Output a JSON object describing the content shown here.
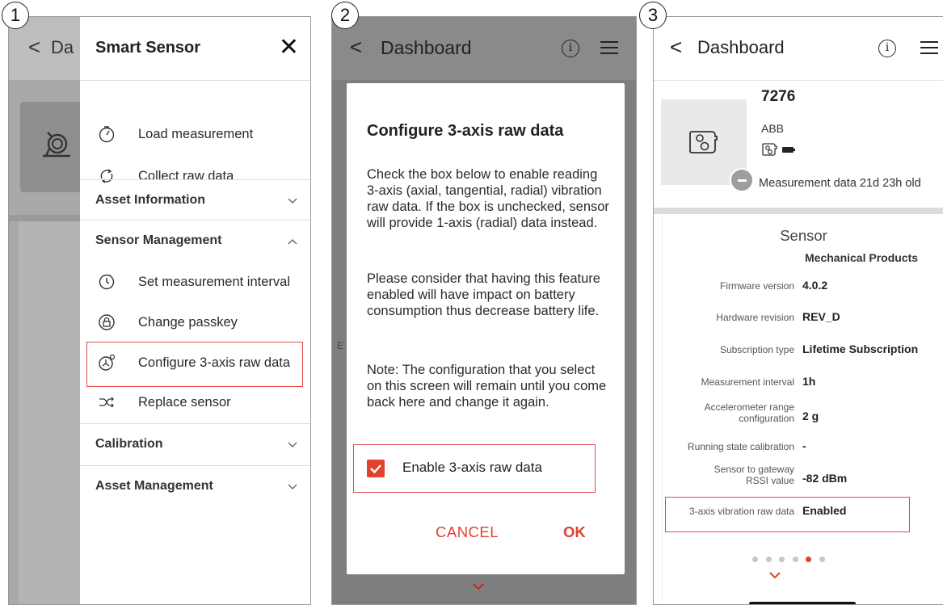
{
  "steps": [
    "1",
    "2",
    "3"
  ],
  "panel1": {
    "bg_back": "<",
    "bg_title": "Da",
    "drawer": {
      "title": "Smart Sensor",
      "close": "✕",
      "items_top": [
        {
          "label": "Load measurement",
          "icon": "gauge-icon"
        },
        {
          "label": "Collect raw data",
          "icon": "refresh-icon"
        }
      ],
      "sections": [
        {
          "label": "Asset Information",
          "chev": "⌄"
        },
        {
          "label": "Sensor Management",
          "chev": "⌃"
        },
        {
          "label": "Calibration",
          "chev": "⌄"
        },
        {
          "label": "Asset Management",
          "chev": "⌄"
        }
      ],
      "sensor_items": [
        {
          "label": "Set measurement interval",
          "icon": "timer-icon"
        },
        {
          "label": "Change passkey",
          "icon": "lock-icon"
        },
        {
          "label": "Configure 3-axis raw data",
          "icon": "axis-icon"
        },
        {
          "label": "Replace sensor",
          "icon": "replace-icon"
        }
      ]
    }
  },
  "panel2": {
    "header": {
      "back": "<",
      "title": "Dashboard",
      "info": "i"
    },
    "bg_letter": "E",
    "dialog": {
      "title": "Configure 3-axis raw data",
      "para1": "Check the box below to enable reading 3-axis (axial, tangential, radial) vibration raw data. If the box is unchecked, sensor will provide 1-axis (radial) data instead.",
      "para2": "Please consider that having this feature enabled will have impact on battery consumption thus decrease battery life.",
      "para3": "Note: The configuration that you select on this screen will remain until you come back here and change it again.",
      "checkbox_label": "Enable 3-axis raw data",
      "checkbox_checked": true,
      "cancel": "CANCEL",
      "ok": "OK"
    }
  },
  "panel3": {
    "header": {
      "back": "<",
      "title": "Dashboard",
      "info": "i"
    },
    "asset": {
      "id": "7276",
      "maker": "ABB",
      "age": "Measurement data 21d 23h old"
    },
    "sensor": {
      "title": "Sensor",
      "cut_value": "Mechanical Products",
      "rows": [
        {
          "key": "Firmware version",
          "value": "4.0.2"
        },
        {
          "key": "Hardware revision",
          "value": "REV_D"
        },
        {
          "key": "Subscription type",
          "value": "Lifetime Subscription"
        },
        {
          "key": "Measurement interval",
          "value": "1h"
        },
        {
          "key": "Accelerometer range configuration",
          "value": "2 g"
        },
        {
          "key": "Running state calibration",
          "value": "-"
        },
        {
          "key": "Sensor to gateway RSSI value",
          "value": "-82 dBm"
        },
        {
          "key": "3-axis vibration raw data",
          "value": "Enabled"
        }
      ],
      "page_count": 6,
      "active_page": 5
    }
  },
  "colors": {
    "accent": "#e2412c",
    "highlight": "#e04a4a"
  }
}
